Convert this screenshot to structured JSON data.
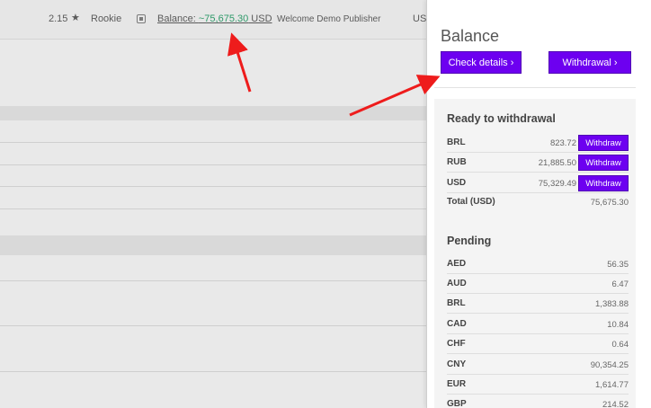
{
  "topbar": {
    "rating": "2.15",
    "rank": "Rookie",
    "balance_label": "Balance: ",
    "balance_amount": "~75,675.30",
    "balance_currency": " USD",
    "welcome": "Welcome Demo Publisher",
    "currency_cut": "US"
  },
  "panel": {
    "title": "Balance",
    "check_details_label": "Check details ›",
    "withdrawal_label": "Withdrawal ›"
  },
  "ready": {
    "title": "Ready to withdrawal",
    "withdraw_label": "Withdraw",
    "rows": [
      {
        "code": "BRL",
        "value": "823.72"
      },
      {
        "code": "RUB",
        "value": "21,885.50"
      },
      {
        "code": "USD",
        "value": "75,329.49"
      }
    ],
    "total_label": "Total (USD)",
    "total_value": "75,675.30"
  },
  "pending": {
    "title": "Pending",
    "rows": [
      {
        "code": "AED",
        "value": "56.35"
      },
      {
        "code": "AUD",
        "value": "6.47"
      },
      {
        "code": "BRL",
        "value": "1,383.88"
      },
      {
        "code": "CAD",
        "value": "10.84"
      },
      {
        "code": "CHF",
        "value": "0.64"
      },
      {
        "code": "CNY",
        "value": "90,354.25"
      },
      {
        "code": "EUR",
        "value": "1,614.77"
      },
      {
        "code": "GBP",
        "value": "214.52"
      }
    ]
  }
}
